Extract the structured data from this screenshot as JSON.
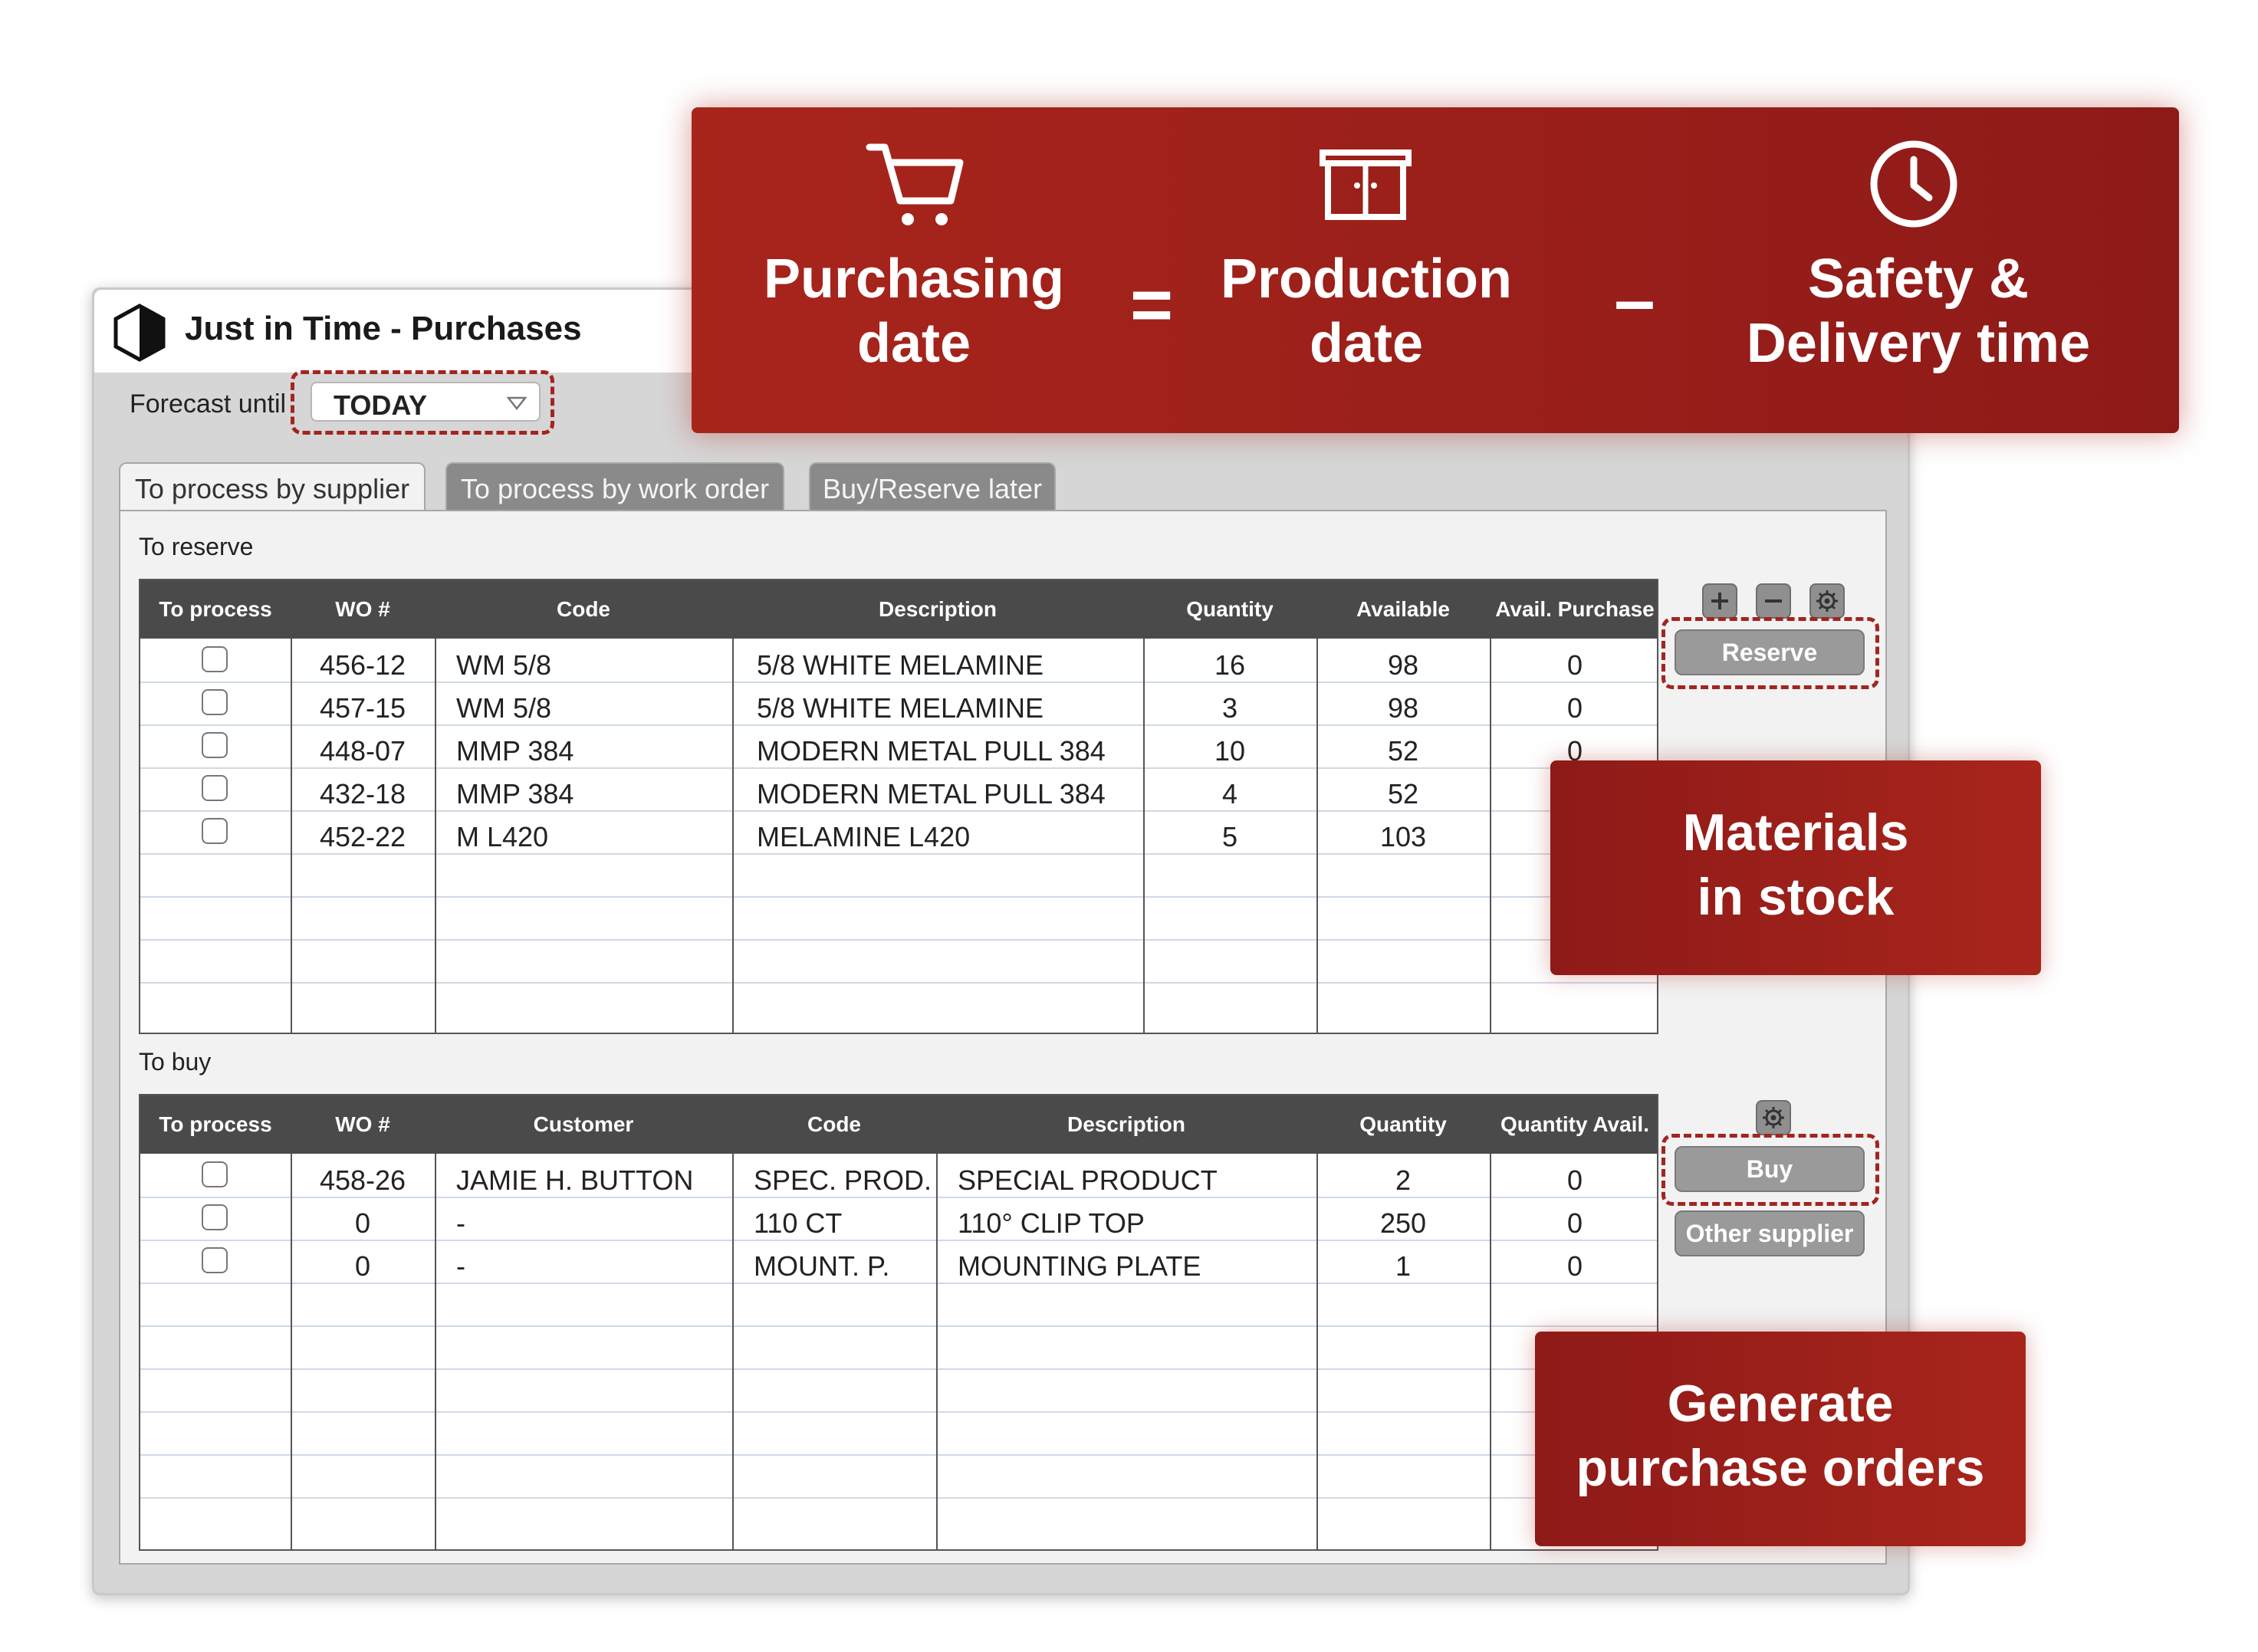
{
  "app": {
    "title": "Just in Time - Purchases"
  },
  "forecast": {
    "label": "Forecast until",
    "value": "TODAY"
  },
  "tabs": [
    {
      "label": "To process by supplier",
      "active": true
    },
    {
      "label": "To process by work order",
      "active": false
    },
    {
      "label": "Buy/Reserve later",
      "active": false
    }
  ],
  "reserve": {
    "section_label": "To reserve",
    "columns": [
      "To process",
      "WO #",
      "Code",
      "Description",
      "Quantity",
      "Available",
      "Avail. Purchase"
    ],
    "rows": [
      {
        "checked": false,
        "wo": "456-12",
        "code": "WM 5/8",
        "description": "5/8 WHITE MELAMINE",
        "quantity": "16",
        "available": "98",
        "avail_purchase": "0"
      },
      {
        "checked": false,
        "wo": "457-15",
        "code": "WM 5/8",
        "description": "5/8 WHITE MELAMINE",
        "quantity": "3",
        "available": "98",
        "avail_purchase": "0"
      },
      {
        "checked": false,
        "wo": "448-07",
        "code": "MMP 384",
        "description": "MODERN METAL PULL 384",
        "quantity": "10",
        "available": "52",
        "avail_purchase": "0"
      },
      {
        "checked": false,
        "wo": "432-18",
        "code": "MMP 384",
        "description": "MODERN METAL PULL 384",
        "quantity": "4",
        "available": "52",
        "avail_purchase": ""
      },
      {
        "checked": false,
        "wo": "452-22",
        "code": "M L420",
        "description": "MELAMINE L420",
        "quantity": "5",
        "available": "103",
        "avail_purchase": ""
      }
    ],
    "reserve_button": "Reserve"
  },
  "buy": {
    "section_label": "To buy",
    "columns": [
      "To process",
      "WO #",
      "Customer",
      "Code",
      "Description",
      "Quantity",
      "Quantity Avail."
    ],
    "rows": [
      {
        "checked": false,
        "wo": "458-26",
        "customer": "JAMIE H. BUTTON",
        "code": "SPEC. PROD.",
        "description": "SPECIAL PRODUCT",
        "quantity": "2",
        "quantity_avail": "0"
      },
      {
        "checked": false,
        "wo": "0",
        "customer": "-",
        "code": "110 CT",
        "description": "110° CLIP TOP",
        "quantity": "250",
        "quantity_avail": "0"
      },
      {
        "checked": false,
        "wo": "0",
        "customer": "-",
        "code": "MOUNT. P.",
        "description": "MOUNTING PLATE",
        "quantity": "1",
        "quantity_avail": "0"
      }
    ],
    "buy_button": "Buy",
    "other_supplier_button": "Other supplier"
  },
  "formula": {
    "term1_line1": "Purchasing",
    "term1_line2": "date",
    "operator1": "=",
    "term2_line1": "Production",
    "term2_line2": "date",
    "operator2": "–",
    "term3_line1": "Safety &",
    "term3_line2": "Delivery time",
    "icons": [
      "cart-icon",
      "cabinet-icon",
      "clock-icon"
    ]
  },
  "callouts": {
    "stock_line1": "Materials",
    "stock_line2": "in stock",
    "orders_line1": "Generate",
    "orders_line2": "purchase orders"
  },
  "colors": {
    "accent": "#a8251c",
    "header": "#4a4a4a",
    "button": "#9a9a9a"
  }
}
